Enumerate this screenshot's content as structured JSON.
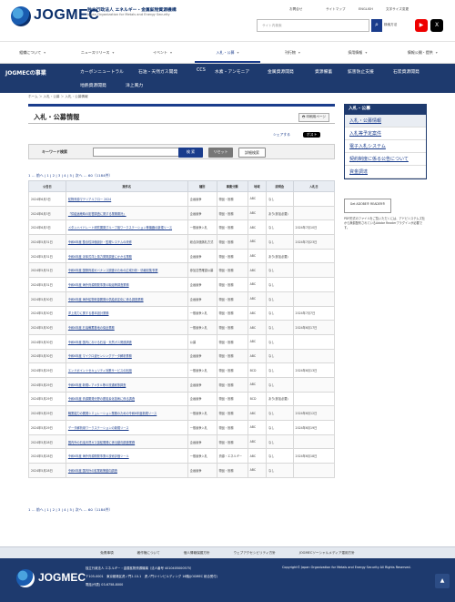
{
  "header": {
    "logo": "JOGMEC",
    "org": "独立行政法人 エネルギー・金属鉱物資源機構",
    "org_sub": "Japan Organization for Metals and Energy Security",
    "util": [
      "お問合せ",
      "サイトマップ",
      "ENGLISH",
      "文字サイズ変更"
    ],
    "search_placeholder": "サイト内検索",
    "search_option": "検索方法"
  },
  "nav1": [
    "組織について",
    "ニュースリリース",
    "イベント",
    "入札・公募",
    "刊行物",
    "採用情報",
    "情報公開・提供"
  ],
  "nav2": {
    "title": "JOGMECの事業",
    "items": [
      "カーボンニュートラル",
      "石油・天然ガス開発",
      "CCS",
      "水素・アンモニア",
      "金属資源開発",
      "資源備蓄",
      "鉱害防止支援",
      "石炭資源開発",
      "地熱資源開発",
      "洋上風力"
    ]
  },
  "breadcrumb": "ホーム ＞ 入札・公募 ＞ 入札・公募情報",
  "page_title": "入札・公募情報",
  "print": "印刷用ページ",
  "share": "シェアする",
  "post": "ポスト",
  "keyword": {
    "label": "キーワード検索",
    "search": "検 索",
    "reset": "リセット",
    "detail": "詳細検索"
  },
  "pager": "1 … 前へ | 1 | 2 | 3 | 4 | 5 | 次へ … 60（1184件）",
  "table": {
    "headers": [
      "公告日",
      "案件名",
      "種別",
      "事業分類",
      "地域",
      "説明会",
      "入札日"
    ],
    "rows": [
      [
        "2024年6月3日",
        "鉱物資源マテリアルフロー 2024",
        "企画競争",
        "物品・役務",
        "ABC",
        "なし",
        ""
      ],
      [
        "2024年6月3日",
        "「供給途絶時の影響調査に関する業務委託」",
        "企画競争",
        "物品・役務",
        "ABC",
        "あり(参加必要)",
        ""
      ],
      [
        "2024年6月3日",
        "メタンハイドレート研究開発グループ用ワークステーション等機器の新規リース",
        "一般競争入札",
        "物品・役務",
        "ABC",
        "なし",
        "2024年7月10日"
      ],
      [
        "2024年5月31日",
        "令和6年度 整合性評価設計・監理システムの改修",
        "総合評価落札方式",
        "物品・役務",
        "ABC",
        "なし",
        "2024年7月23日"
      ],
      [
        "2024年5月31日",
        "令和6年度 浮体式洋上風力発電調査にかかる業務",
        "企画競争",
        "物品・役務",
        "ABC",
        "あり(参加必要)",
        ""
      ],
      [
        "2024年5月31日",
        "令和6年度 国際資源ガバナンス調査のための広域分析・情報収集事業",
        "参加意思確認公募",
        "物品・役務",
        "ABC",
        "なし",
        ""
      ],
      [
        "2024年5月31日",
        "令和6年度 海外資源開発事業の取組等調査業務",
        "企画競争",
        "物品・役務",
        "ABC",
        "なし",
        ""
      ],
      [
        "2024年5月30日",
        "令和6年度 海外鉱物資源開発の供給安定化に係る調査業務",
        "企画競争",
        "物品・役務",
        "ABC",
        "なし",
        ""
      ],
      [
        "2024年5月30日",
        "洋上風力に関する基本設計業務",
        "一般競争入札",
        "物品・役務",
        "ABC",
        "なし",
        "2024年7月7日"
      ],
      [
        "2024年5月30日",
        "令和6年度 石油備蓄基地の保全業務",
        "一般競争入札",
        "物品・役務",
        "ABC",
        "なし",
        "2024年6月17日"
      ],
      [
        "2024年5月30日",
        "令和6年度 国内における石油・天然ガス関連調査",
        "公募",
        "物品・役務",
        "ABC",
        "なし",
        ""
      ],
      [
        "2024年5月30日",
        "令和6年度 マイクロ波センシングデータ解析業務",
        "企画競争",
        "物品・役務",
        "ABC",
        "なし",
        ""
      ],
      [
        "2024年5月29日",
        "エンドポイントセキュリティ対策サービスの利用",
        "一般競争入札",
        "物品・役務",
        "BCD",
        "なし",
        "2024年6月13日"
      ],
      [
        "2024年5月29日",
        "令和6年度 新規レアメタル等の流通実態調査",
        "企画競争",
        "物品・役務",
        "ABC",
        "なし",
        ""
      ],
      [
        "2024年5月29日",
        "令和6年度 資源開発分野の脱炭素化技術に係る調査",
        "企画競争",
        "物品・役務",
        "BCD",
        "あり(参加必要)",
        ""
      ],
      [
        "2024年5月29日",
        "職業能力の開発シミュレーション業務のための令和6年度新規リース",
        "一般競争入札",
        "物品・役務",
        "ABC",
        "なし",
        "2024年6月12日"
      ],
      [
        "2024年5月29日",
        "データ解析用ワークステーションの新規リース",
        "一般競争入札",
        "物品・役務",
        "ABC",
        "なし",
        "2024年6月19日"
      ],
      [
        "2024年5月28日",
        "国内外の石油天然ガス探鉱開発に係る動向調査業務",
        "企画競争",
        "物品・役務",
        "ABC",
        "なし",
        ""
      ],
      [
        "2024年5月28日",
        "令和6年度 海外資源開発事業の技術評価ツール",
        "一般競争入札",
        "資源・エネルギー",
        "ABC",
        "なし",
        "2024年6月18日"
      ],
      [
        "2024年5月28日",
        "令和6年度 国内外の鉱業政策動向調査",
        "企画競争",
        "物品・役務",
        "ABC",
        "なし",
        ""
      ]
    ]
  },
  "pager2": "1 … 前へ | 1 | 2 | 3 | 4 | 5 | 次へ … 60（1184件）",
  "side": {
    "title": "入札・公募",
    "items": [
      "入札・公募情報",
      "入札等予定案件",
      "電子入札システム",
      "契約制度に係る公告について",
      "資金調達"
    ],
    "adobe": "Get ADOBE® READER®",
    "adobe_text": "PDF形式のファイルをご覧いただくには、アドビシステムズ社から無償配布されているAdobe Readerプラグインが必要です。"
  },
  "footer": {
    "links": [
      "免責事項",
      "著作権について",
      "個人情報保護方針",
      "ウェブアクセシビリティ方針",
      "JOGMECソーシャルメディア運用方針"
    ],
    "logo": "JOGMEC",
    "info1": "独立行政法人 エネルギー・金属鉱物資源機構（法人番号 4010405000575）",
    "info2": "〒105-0001　東京都港区虎ノ門2-10-1　虎ノ門ツインビルディング 16階(JOGMEC 総合受付)",
    "info3": "電話(代表) 03-6758-8000",
    "copyright": "Copyright© Japan Organization for Metals and Energy Security All Rights Reserved."
  }
}
